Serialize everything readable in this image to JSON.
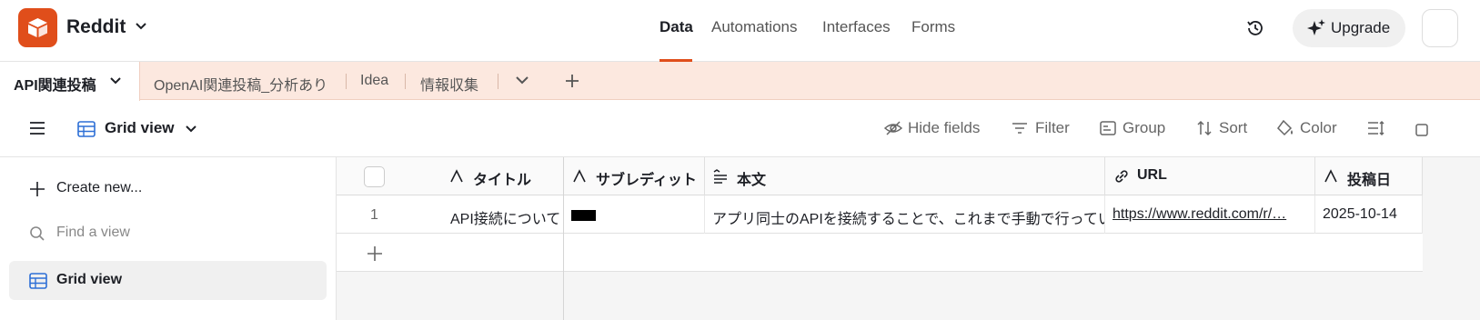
{
  "header": {
    "base_name": "Reddit",
    "nav": [
      "Data",
      "Automations",
      "Interfaces",
      "Forms"
    ],
    "active_nav": "Data",
    "upgrade_label": "Upgrade"
  },
  "tables": {
    "active": "API関連投稿",
    "others": [
      "OpenAI関連投稿_分析あり",
      "Idea",
      "情報収集"
    ]
  },
  "viewbar": {
    "view_name": "Grid view",
    "tools": [
      "Hide fields",
      "Filter",
      "Group",
      "Sort",
      "Color"
    ]
  },
  "sidebar": {
    "create_label": "Create new...",
    "find_placeholder": "Find a view",
    "views": [
      "Grid view"
    ]
  },
  "grid": {
    "columns": [
      "タイトル",
      "サブレディット",
      "本文",
      "URL",
      "投稿日"
    ],
    "rows": [
      {
        "num": "1",
        "title": "API接続について",
        "subreddit": "",
        "body": "アプリ同士のAPIを接続することで、これまで手動で行っていた…",
        "url": "https://www.reddit.com/r/…",
        "date": "2025-10-14"
      }
    ]
  },
  "colors": {
    "brand": "#e04e1b",
    "tab_strip": "#fce8df"
  }
}
